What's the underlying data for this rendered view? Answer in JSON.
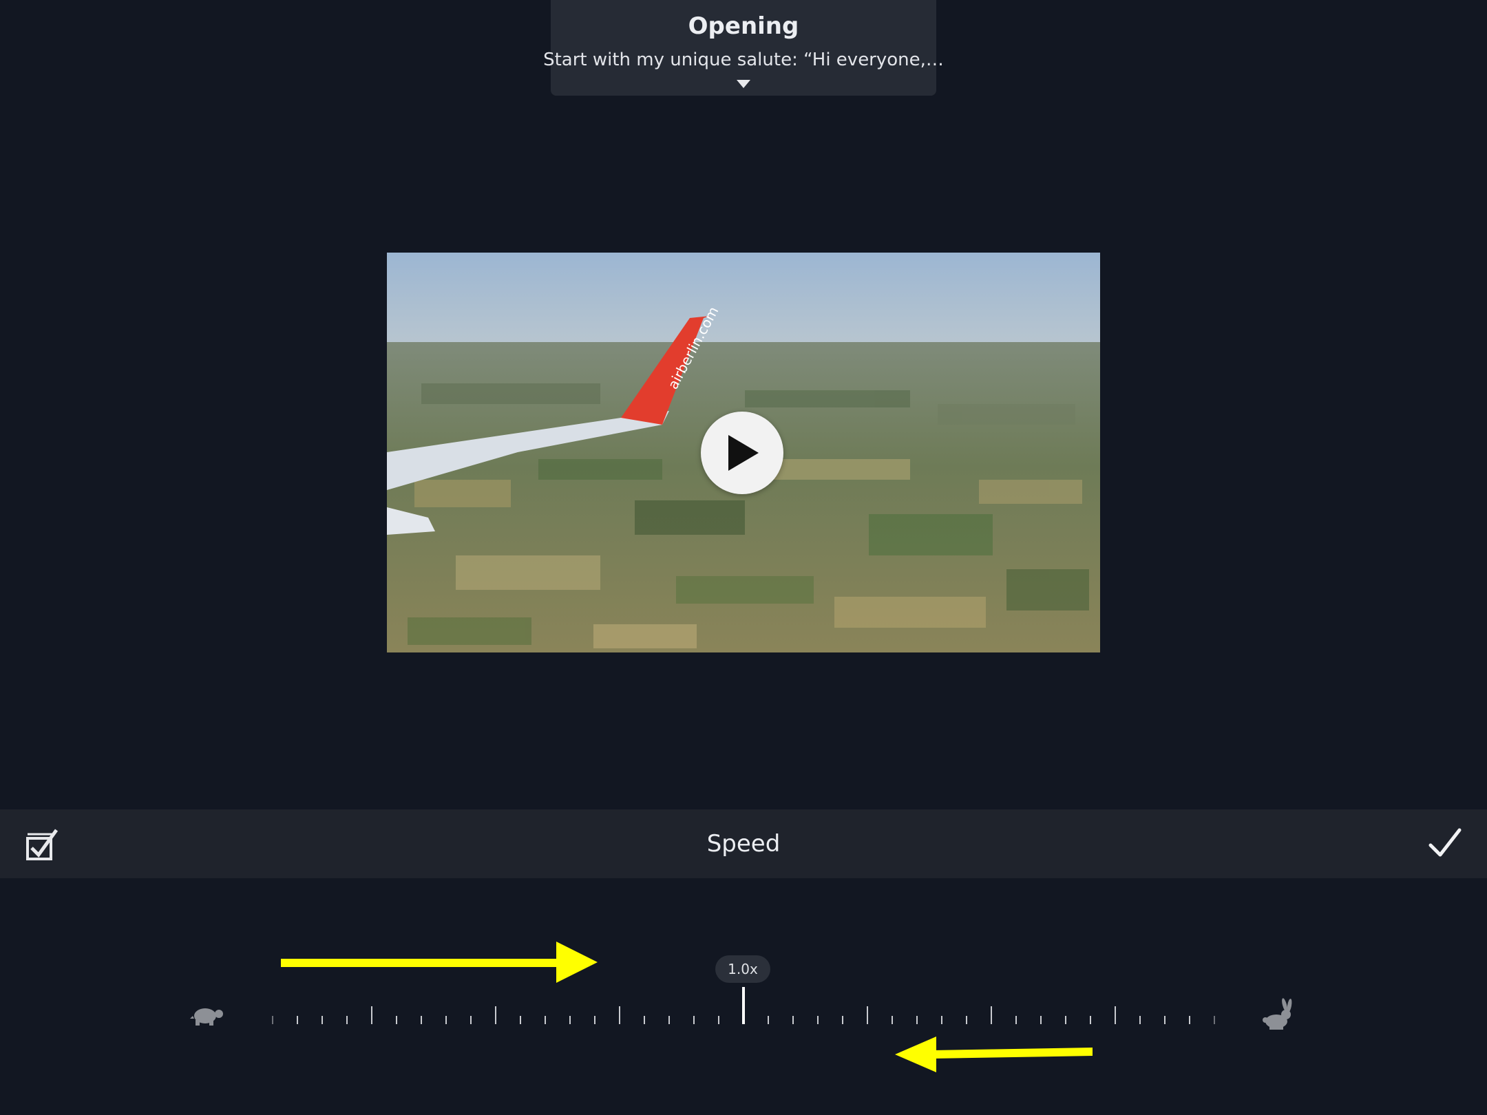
{
  "header": {
    "title": "Opening",
    "subtitle": "Start with my unique salute: “Hi everyone,…",
    "expand_icon": "caret-down-icon"
  },
  "video": {
    "play_icon": "play-icon",
    "wing_text": "airberlin.com"
  },
  "toolbar": {
    "title": "Speed",
    "left_icon": "checklist-icon",
    "right_icon": "checkmark-icon"
  },
  "speed": {
    "value_label": "1.0x",
    "slow_icon": "turtle-icon",
    "fast_icon": "rabbit-icon"
  },
  "annotations": {
    "color": "#ffff00"
  }
}
